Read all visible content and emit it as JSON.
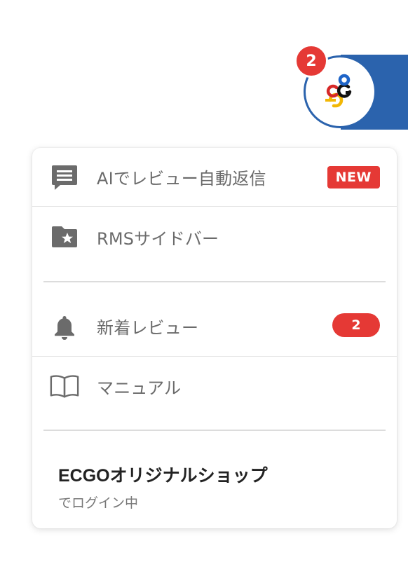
{
  "launcher": {
    "badge_count": "2",
    "logo_icon": "ecgo-logo-icon"
  },
  "menu": {
    "items": [
      {
        "label": "AIでレビュー自動返信",
        "icon": "chat-icon",
        "badge": "NEW"
      },
      {
        "label": "RMSサイドバー",
        "icon": "folder-star-icon"
      },
      {
        "label": "新着レビュー",
        "icon": "bell-icon",
        "badge": "2"
      },
      {
        "label": "マニュアル",
        "icon": "book-icon"
      }
    ]
  },
  "shop": {
    "name": "ECGOオリジナルショップ",
    "status": "でログイン中"
  },
  "colors": {
    "accent_blue": "#2b63ad",
    "badge_red": "#e53935",
    "icon_gray": "#6b6b6b"
  }
}
